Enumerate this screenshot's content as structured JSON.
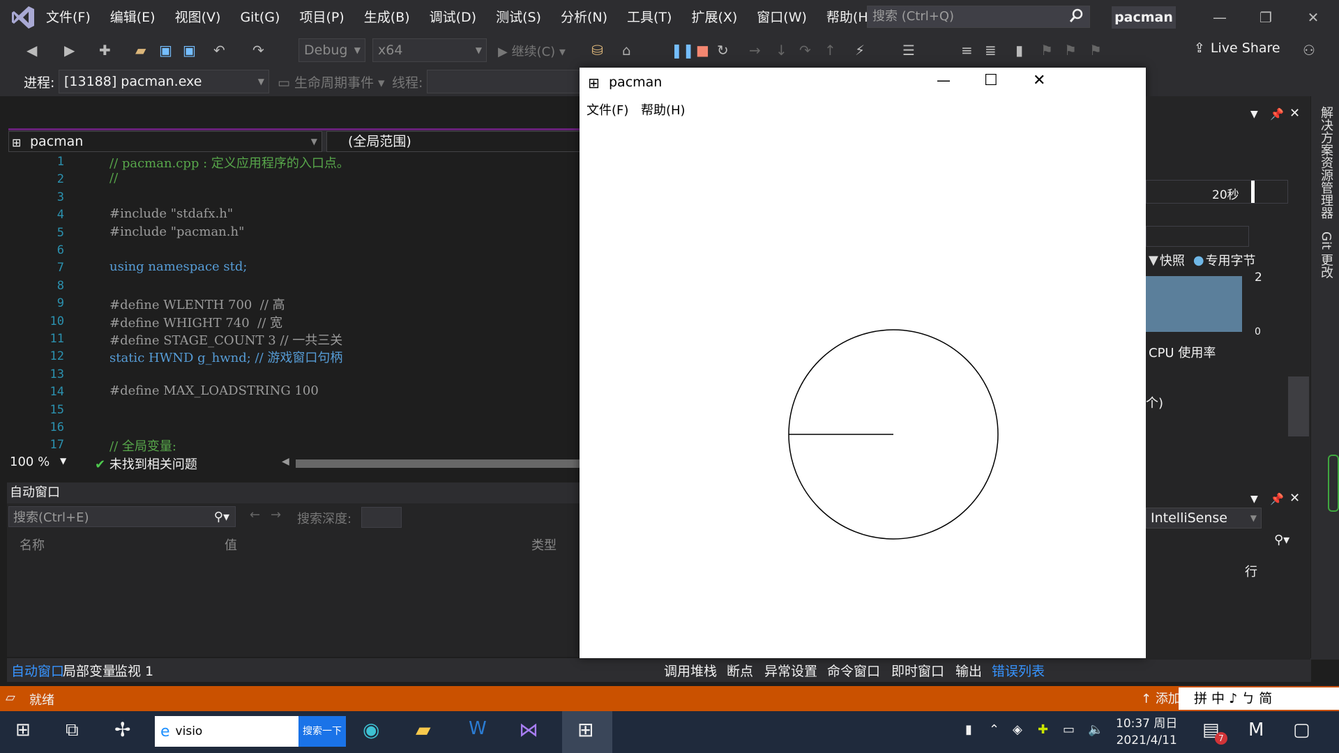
{
  "menubar": {
    "items": [
      "文件(F)",
      "编辑(E)",
      "视图(V)",
      "Git(G)",
      "项目(P)",
      "生成(B)",
      "调试(D)",
      "测试(S)",
      "分析(N)",
      "工具(T)",
      "扩展(X)",
      "窗口(W)",
      "帮助(H)"
    ],
    "search_placeholder": "搜索 (Ctrl+Q)",
    "solution_name": "pacman"
  },
  "toolbar": {
    "config": "Debug",
    "platform": "x64",
    "continue_label": "继续(C)",
    "live_share": "Live Share"
  },
  "procbar": {
    "process_label": "进程:",
    "process_value": "[13188] pacman.exe",
    "lifecycle_label": "生命周期事件",
    "thread_label": "线程:"
  },
  "editor": {
    "file_combo": "pacman",
    "scope_combo": "(全局范围)",
    "zoom": "100 %",
    "issues": "未找到相关问题",
    "lines": [
      {
        "n": "1",
        "t": "// pacman.cpp : 定义应用程序的入口点。",
        "c": "cm"
      },
      {
        "n": "2",
        "t": "//",
        "c": "cm"
      },
      {
        "n": "3",
        "t": "",
        "c": ""
      },
      {
        "n": "4",
        "t": "#include \"stdafx.h\"",
        "c": "inc"
      },
      {
        "n": "5",
        "t": "#include \"pacman.h\"",
        "c": "inc"
      },
      {
        "n": "6",
        "t": "",
        "c": ""
      },
      {
        "n": "7",
        "t": "using namespace std;",
        "c": "using"
      },
      {
        "n": "8",
        "t": "",
        "c": ""
      },
      {
        "n": "9",
        "t": "#define WLENTH 700  // 高",
        "c": "def"
      },
      {
        "n": "10",
        "t": "#define WHIGHT 740  // 宽",
        "c": "def"
      },
      {
        "n": "11",
        "t": "#define STAGE_COUNT 3 // 一共三关",
        "c": "def"
      },
      {
        "n": "12",
        "t": "static HWND g_hwnd; // 游戏窗口句柄",
        "c": "static"
      },
      {
        "n": "13",
        "t": "",
        "c": ""
      },
      {
        "n": "14",
        "t": "#define MAX_LOADSTRING 100",
        "c": "def"
      },
      {
        "n": "15",
        "t": "",
        "c": ""
      },
      {
        "n": "16",
        "t": "",
        "c": ""
      },
      {
        "n": "17",
        "t": "// 全局变量:",
        "c": "cm"
      }
    ]
  },
  "autos": {
    "title": "自动窗口",
    "search_placeholder": "搜索(Ctrl+E)",
    "depth_label": "搜索深度:",
    "col_name": "名称",
    "col_value": "值",
    "col_type": "类型"
  },
  "bottom_tabs_left": [
    "自动窗口",
    "局部变量",
    "监视 1"
  ],
  "bottom_tabs_right": [
    "调用堆栈",
    "断点",
    "异常设置",
    "命令窗口",
    "即时窗口",
    "输出",
    "错误列表"
  ],
  "status": {
    "ready": "就绪",
    "add": "添加"
  },
  "pacman_window": {
    "title": "pacman",
    "menu": [
      "文件(F)",
      "帮助(H)"
    ]
  },
  "right_panel": {
    "timer": "20秒",
    "snapshot": "快照",
    "private_bytes": "专用字节",
    "num_top": "2",
    "num_bottom": "0",
    "cpu_label": "CPU 使用率",
    "paren": "个)",
    "intellisense": "IntelliSense",
    "row_label": "行"
  },
  "side_tabs": [
    "解决方案资源管理器",
    "Git 更改"
  ],
  "ime": "拼 中 ♪ ㄅ 简",
  "taskbar": {
    "search_text": "visio",
    "search_button": "搜索一下",
    "time": "10:37 周日",
    "date": "2021/4/11",
    "notif_count": "7"
  }
}
